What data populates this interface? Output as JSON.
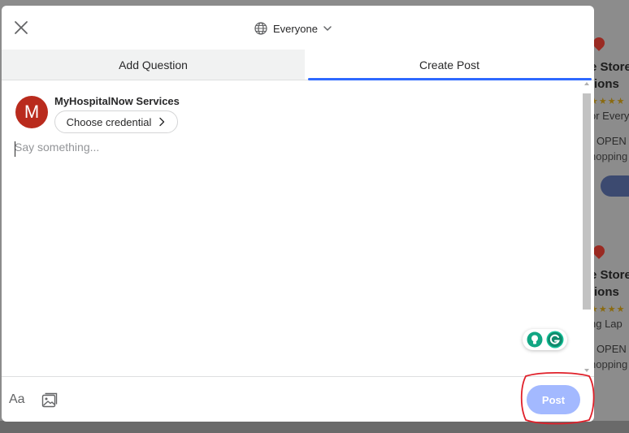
{
  "background": {
    "card1": {
      "title_1": "e Store",
      "title_2": "tions",
      "stars": "★★★★",
      "sub": "or Everyo",
      "open": "· OPEN",
      "shop": "hopping"
    },
    "card2": {
      "title_1": "e Store",
      "title_2": "tions",
      "stars": "★★★★",
      "sub": "ng Lap",
      "open": "· OPEN",
      "shop": "hopping"
    }
  },
  "header": {
    "close_icon": "close-icon",
    "audience": {
      "label": "Everyone",
      "icon": "globe-icon",
      "chevron": "chevron-down-icon"
    }
  },
  "tabs": [
    {
      "label": "Add Question",
      "active": false
    },
    {
      "label": "Create Post",
      "active": true
    }
  ],
  "composer": {
    "avatar_letter": "M",
    "avatar_color": "#b92b1d",
    "user_name": "MyHospitalNow Services",
    "credential_label": "Choose credential",
    "placeholder": "Say something...",
    "value": ""
  },
  "footer": {
    "font_label": "Aa",
    "image_icon": "image-icon",
    "post_label": "Post",
    "post_color": "#a3b9ff"
  },
  "colors": {
    "accent": "#2e69ff",
    "annotation": "#e0202a"
  }
}
